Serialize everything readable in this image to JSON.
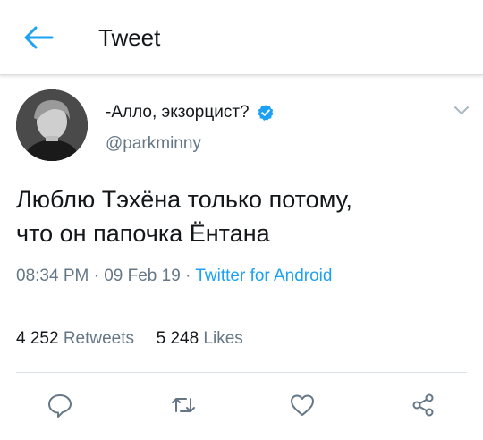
{
  "header": {
    "title": "Tweet"
  },
  "user": {
    "name": "-Алло, экзорцист?",
    "handle": "@parkminny"
  },
  "tweet": {
    "text_line1": "Люблю Тэхёна только потому,",
    "text_line2": "что он папочка Ёнтана",
    "time": "08:34 PM",
    "date": "09 Feb 19",
    "source": "Twitter for Android"
  },
  "stats": {
    "retweets_count": "4 252",
    "retweets_label": "Retweets",
    "likes_count": "5 248",
    "likes_label": "Likes"
  },
  "colors": {
    "accent": "#1da1f2",
    "secondary": "#657786",
    "text": "#14171a"
  },
  "icons": [
    "back-arrow-icon",
    "verified-badge-icon",
    "chevron-down-icon",
    "reply-icon",
    "retweet-icon",
    "like-icon",
    "share-icon"
  ]
}
